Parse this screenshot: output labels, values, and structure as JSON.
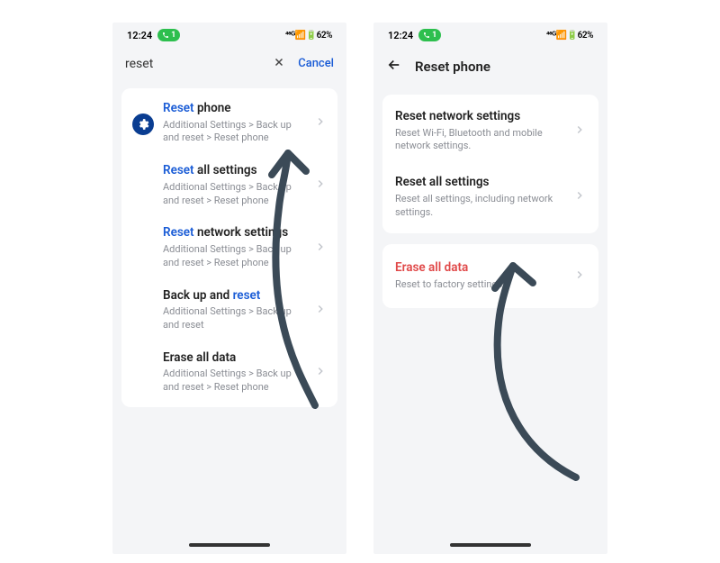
{
  "status": {
    "time": "12:24",
    "pill": "1",
    "right": "⁴⁶ᴳ📶🔋62%"
  },
  "phone1": {
    "query": "reset",
    "cancel": "Cancel",
    "items": [
      {
        "t1": "Reset",
        "t2": " phone",
        "sub": "Additional Settings > Back up and reset > Reset phone"
      },
      {
        "t1": "Reset",
        "t2": " all settings",
        "sub": "Additional Settings > Back up and reset > Reset phone"
      },
      {
        "t1": "Reset",
        "t2": " network settings",
        "sub": "Additional Settings > Back up and reset > Reset phone"
      },
      {
        "t1a": "Back up and ",
        "t1b": "reset",
        "sub": "Additional Settings > Back up and reset"
      },
      {
        "title": "Erase all data",
        "sub": "Additional Settings > Back up and reset > Reset phone"
      }
    ]
  },
  "phone2": {
    "header": "Reset phone",
    "group1": [
      {
        "title": "Reset network settings",
        "sub": "Reset Wi-Fi, Bluetooth and mobile network settings."
      },
      {
        "title": "Reset all settings",
        "sub": "Reset all settings, including network settings."
      }
    ],
    "group2": [
      {
        "title": "Erase all data",
        "sub": "Reset to factory settings"
      }
    ]
  }
}
